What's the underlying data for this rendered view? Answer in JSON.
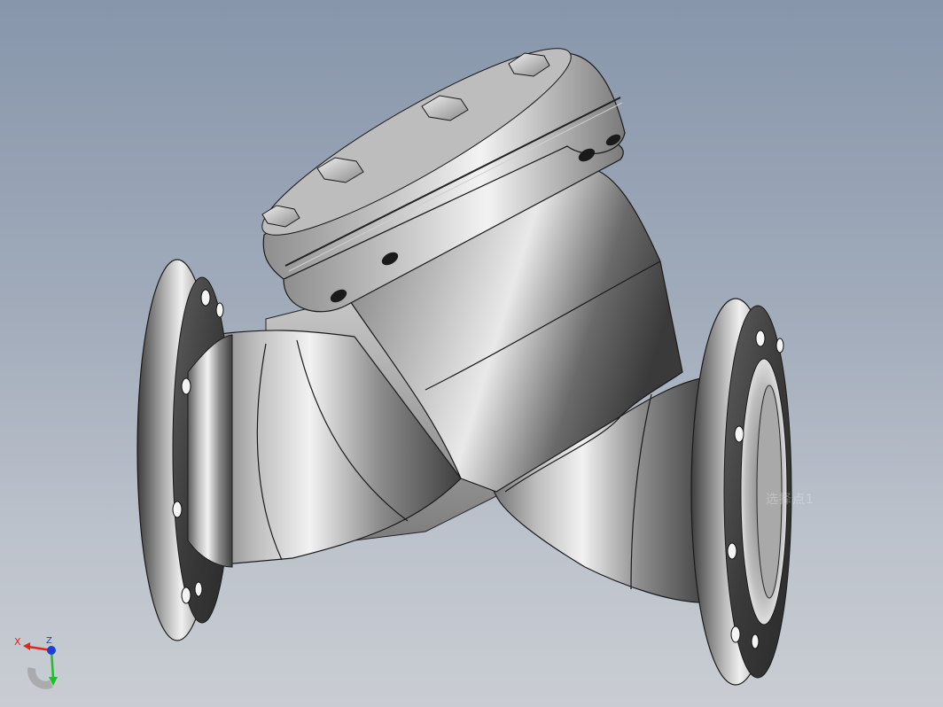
{
  "viewport": {
    "background_top": "#8796ab",
    "background_bottom": "#c9cdd3",
    "model": "y-strainer-flanged-valve"
  },
  "triad": {
    "x_label": "X",
    "y_label": "Y",
    "z_label": "Z",
    "x_color": "#e0261f",
    "y_color": "#1fbf28",
    "z_color": "#1a3fd6"
  },
  "overlay": {
    "watermark": "选择点1"
  },
  "colors": {
    "steel_light": "#e6e6e6",
    "steel_mid": "#9a9a9a",
    "steel_dark": "#4a4a4a",
    "edge": "#111111"
  }
}
